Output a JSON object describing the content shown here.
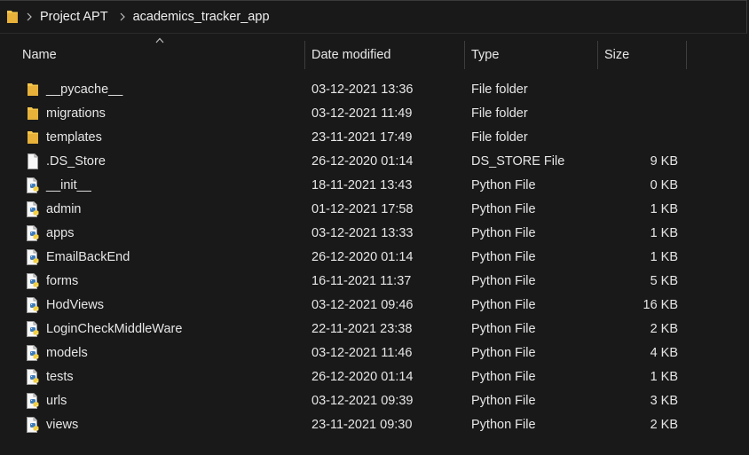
{
  "address_bar": {
    "folder_icon": "folder-icon",
    "breadcrumbs": [
      "Project APT",
      "academics_tracker_app"
    ]
  },
  "columns": {
    "name": "Name",
    "date_modified": "Date modified",
    "type": "Type",
    "size": "Size"
  },
  "files": [
    {
      "icon": "folder-icon",
      "name": "__pycache__",
      "date": "03-12-2021 13:36",
      "type": "File folder",
      "size": ""
    },
    {
      "icon": "folder-icon",
      "name": "migrations",
      "date": "03-12-2021 11:49",
      "type": "File folder",
      "size": ""
    },
    {
      "icon": "folder-icon",
      "name": "templates",
      "date": "23-11-2021 17:49",
      "type": "File folder",
      "size": ""
    },
    {
      "icon": "file-icon",
      "name": ".DS_Store",
      "date": "26-12-2020 01:14",
      "type": "DS_STORE File",
      "size": "9 KB"
    },
    {
      "icon": "python-file-icon",
      "name": "__init__",
      "date": "18-11-2021 13:43",
      "type": "Python File",
      "size": "0 KB"
    },
    {
      "icon": "python-file-icon",
      "name": "admin",
      "date": "01-12-2021 17:58",
      "type": "Python File",
      "size": "1 KB"
    },
    {
      "icon": "python-file-icon",
      "name": "apps",
      "date": "03-12-2021 13:33",
      "type": "Python File",
      "size": "1 KB"
    },
    {
      "icon": "python-file-icon",
      "name": "EmailBackEnd",
      "date": "26-12-2020 01:14",
      "type": "Python File",
      "size": "1 KB"
    },
    {
      "icon": "python-file-icon",
      "name": "forms",
      "date": "16-11-2021 11:37",
      "type": "Python File",
      "size": "5 KB"
    },
    {
      "icon": "python-file-icon",
      "name": "HodViews",
      "date": "03-12-2021 09:46",
      "type": "Python File",
      "size": "16 KB"
    },
    {
      "icon": "python-file-icon",
      "name": "LoginCheckMiddleWare",
      "date": "22-11-2021 23:38",
      "type": "Python File",
      "size": "2 KB"
    },
    {
      "icon": "python-file-icon",
      "name": "models",
      "date": "03-12-2021 11:46",
      "type": "Python File",
      "size": "4 KB"
    },
    {
      "icon": "python-file-icon",
      "name": "tests",
      "date": "26-12-2020 01:14",
      "type": "Python File",
      "size": "1 KB"
    },
    {
      "icon": "python-file-icon",
      "name": "urls",
      "date": "03-12-2021 09:39",
      "type": "Python File",
      "size": "3 KB"
    },
    {
      "icon": "python-file-icon",
      "name": "views",
      "date": "23-11-2021 09:30",
      "type": "Python File",
      "size": "2 KB"
    }
  ],
  "colors": {
    "background": "#191919",
    "text": "#e6e6e6",
    "folder": "#f3c54b",
    "python_blue": "#3d7ab8",
    "python_yellow": "#f2cf45"
  }
}
